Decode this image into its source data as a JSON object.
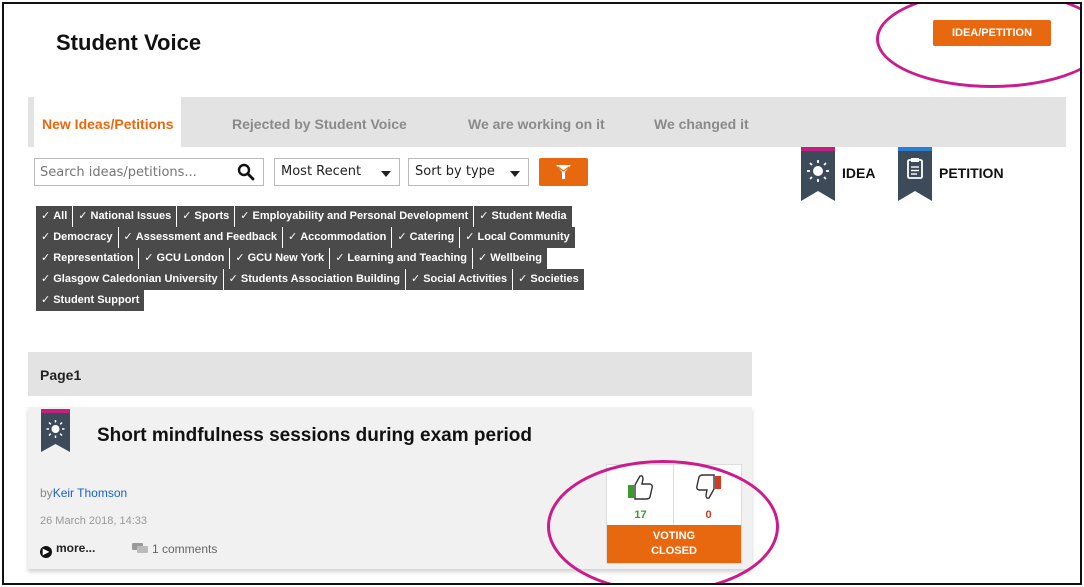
{
  "header": {
    "title": "Student Voice",
    "primary_button": "IDEA/PETITION"
  },
  "tabs": [
    {
      "label": "New Ideas/Petitions",
      "active": true
    },
    {
      "label": "Rejected by Student Voice",
      "active": false
    },
    {
      "label": "We are working on it",
      "active": false
    },
    {
      "label": "We changed it",
      "active": false
    }
  ],
  "toolbar": {
    "search_placeholder": "Search ideas/petitions...",
    "sort_order": "Most Recent",
    "sort_type": "Sort by type"
  },
  "legend": {
    "idea_label": "IDEA",
    "petition_label": "PETITION"
  },
  "tags": [
    [
      "All",
      "National Issues",
      "Sports",
      "Employability and Personal Development",
      "Student Media"
    ],
    [
      "Democracy",
      "Assessment and Feedback",
      "Accommodation",
      "Catering",
      "Local Community"
    ],
    [
      "Representation",
      "GCU London",
      "GCU New York",
      "Learning and Teaching",
      "Wellbeing"
    ],
    [
      "Glasgow Caledonian University",
      "Students Association Building",
      "Social Activities",
      "Societies"
    ],
    [
      "Student Support"
    ]
  ],
  "page_label": "Page1",
  "post": {
    "title": "Short mindfulness sessions during exam period",
    "by_prefix": "by",
    "author": "Keir Thomson",
    "date": "26 March 2018, 14:33",
    "more_label": "more...",
    "comments": "1 comments",
    "votes_up": "17",
    "votes_down": "0",
    "status_line1": "VOTING",
    "status_line2": "CLOSED"
  },
  "colors": {
    "accent": "#e8680f",
    "highlight_circle": "#cc1b8c",
    "idea_badge": "#c0207e",
    "petition_badge": "#2a7fd4",
    "badge_body": "#3d4a5a",
    "tag_bg": "#4a4a4a"
  }
}
